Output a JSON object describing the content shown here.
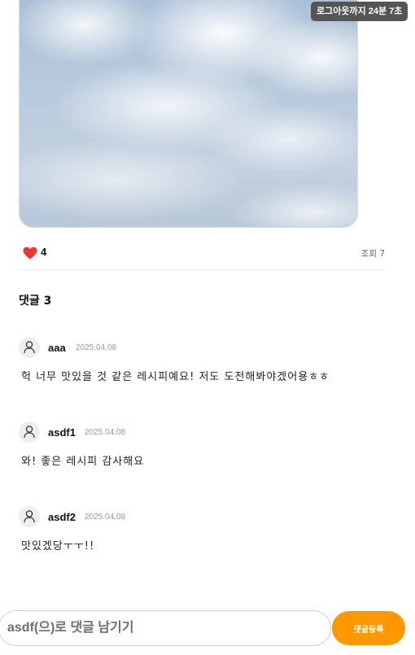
{
  "session": {
    "logout_timer": "로그아웃까지 24분 7초"
  },
  "post": {
    "like_count": "4",
    "view_label": "조회 7"
  },
  "comments": {
    "title": "댓글 3",
    "items": [
      {
        "author": "aaa",
        "date": "2025.04.08",
        "text": "헉 너무 맛있을 것 같은 레시피예요! 저도 도전해봐야겠어용ㅎㅎ"
      },
      {
        "author": "asdf1",
        "date": "2025.04.08",
        "text": "와! 좋은 레시피 감사해요"
      },
      {
        "author": "asdf2",
        "date": "2025.04.08",
        "text": "맛있겠당ㅜㅜ!!"
      }
    ]
  },
  "comment_form": {
    "placeholder": "asdf(으)로 댓글 남기기",
    "submit_label": "댓글등록"
  },
  "colors": {
    "accent": "#ff9800",
    "like": "#e53935",
    "timer_bg": "#555555"
  },
  "icons": {
    "like": "heart-icon",
    "avatar": "user-icon"
  }
}
